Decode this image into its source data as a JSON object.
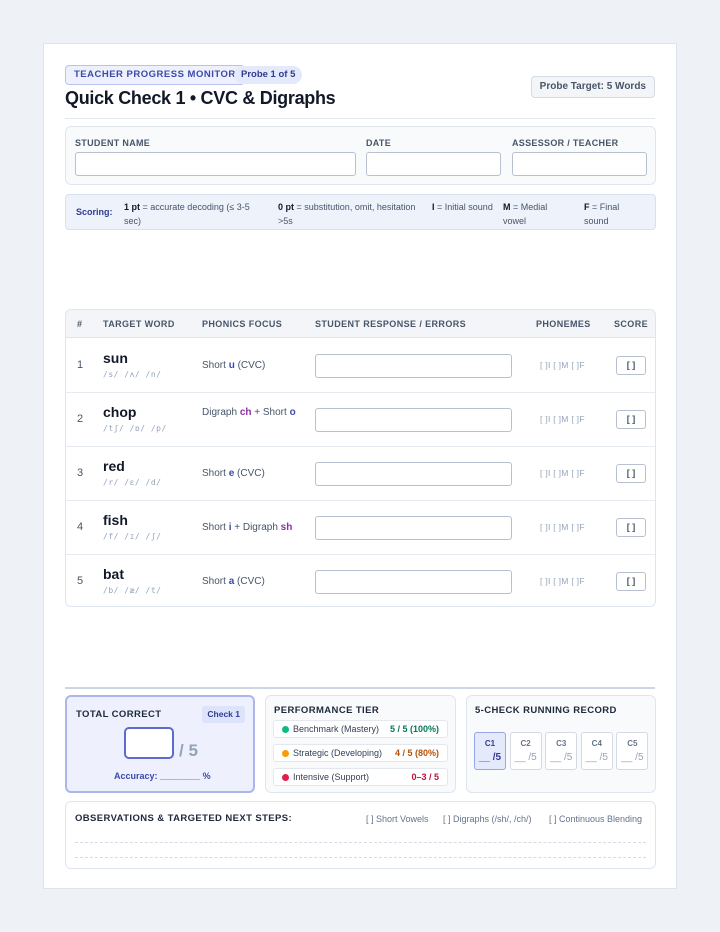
{
  "header": {
    "badge": "TEACHER PROGRESS MONITOR",
    "probe": "Probe 1 of 5",
    "title": "Quick Check 1 • CVC & Digraphs",
    "target": "Probe Target: 5 Words"
  },
  "fields": {
    "student": "STUDENT NAME",
    "date": "DATE",
    "assessor": "ASSESSOR / TEACHER"
  },
  "scoring": {
    "label": "Scoring:",
    "one_pt_key": "1 pt",
    "one_pt_text": "= accurate decoding (≤ 3-5 sec)",
    "zero_pt_key": "0 pt",
    "zero_pt_text": "= substitution, omit, hesitation >5s",
    "i_key": "I",
    "i_text": "= Initial sound",
    "m_key": "M",
    "m_text": "= Medial vowel",
    "f_key": "F",
    "f_text": "= Final sound"
  },
  "table": {
    "headers": [
      "#",
      "TARGET WORD",
      "PHONICS FOCUS",
      "STUDENT RESPONSE / ERRORS",
      "PHONEMES",
      "SCORE"
    ],
    "phoneme_marks": "[ ]I [ ]M [ ]F",
    "score_box": "[ ]",
    "rows": [
      {
        "num": "1",
        "word": "sun",
        "ipa": "/s/ /ʌ/ /n/",
        "f1": "Short ",
        "h1": "u",
        "f2": " (CVC)",
        "h2": "",
        "f3": ""
      },
      {
        "num": "2",
        "word": "chop",
        "ipa": "/tʃ/ /ɒ/ /p/",
        "f1": "Digraph ",
        "h1": "ch",
        "f2": " + Short ",
        "h2": "o",
        "f3": ""
      },
      {
        "num": "3",
        "word": "red",
        "ipa": "/r/ /ɛ/ /d/",
        "f1": "Short ",
        "h1": "e",
        "f2": " (CVC)",
        "h2": "",
        "f3": ""
      },
      {
        "num": "4",
        "word": "fish",
        "ipa": "/f/ /ɪ/ /ʃ/",
        "f1": "Short ",
        "h1": "i",
        "f2": " + Digraph ",
        "h2": "sh",
        "f3": ""
      },
      {
        "num": "5",
        "word": "bat",
        "ipa": "/b/ /æ/ /t/",
        "f1": "Short ",
        "h1": "a",
        "f2": " (CVC)",
        "h2": "",
        "f3": ""
      }
    ]
  },
  "total": {
    "title": "TOTAL CORRECT",
    "check": "Check 1",
    "denominator": "/ 5",
    "accuracy": "Accuracy: ________ %"
  },
  "tier": {
    "title": "PERFORMANCE TIER",
    "items": [
      {
        "label": "Benchmark (Mastery)",
        "value": "5 / 5 (100%)",
        "color": "#10b981",
        "text_color": "#047857"
      },
      {
        "label": "Strategic (Developing)",
        "value": "4 / 5 (80%)",
        "color": "#f59e0b",
        "text_color": "#b45309"
      },
      {
        "label": "Intensive (Support)",
        "value": "0–3 / 5",
        "color": "#e11d48",
        "text_color": "#be123c"
      }
    ]
  },
  "record": {
    "title": "5-CHECK RUNNING RECORD",
    "checks": [
      {
        "label": "C1",
        "value": "__ /5"
      },
      {
        "label": "C2",
        "value": "__ /5"
      },
      {
        "label": "C3",
        "value": "__ /5"
      },
      {
        "label": "C4",
        "value": "__ /5"
      },
      {
        "label": "C5",
        "value": "__ /5"
      }
    ]
  },
  "observations": {
    "title": "OBSERVATIONS & TARGETED NEXT STEPS:",
    "checks": [
      "[ ] Short Vowels",
      "[ ] Digraphs (/sh/, /ch/)",
      "[ ] Continuous Blending"
    ]
  }
}
